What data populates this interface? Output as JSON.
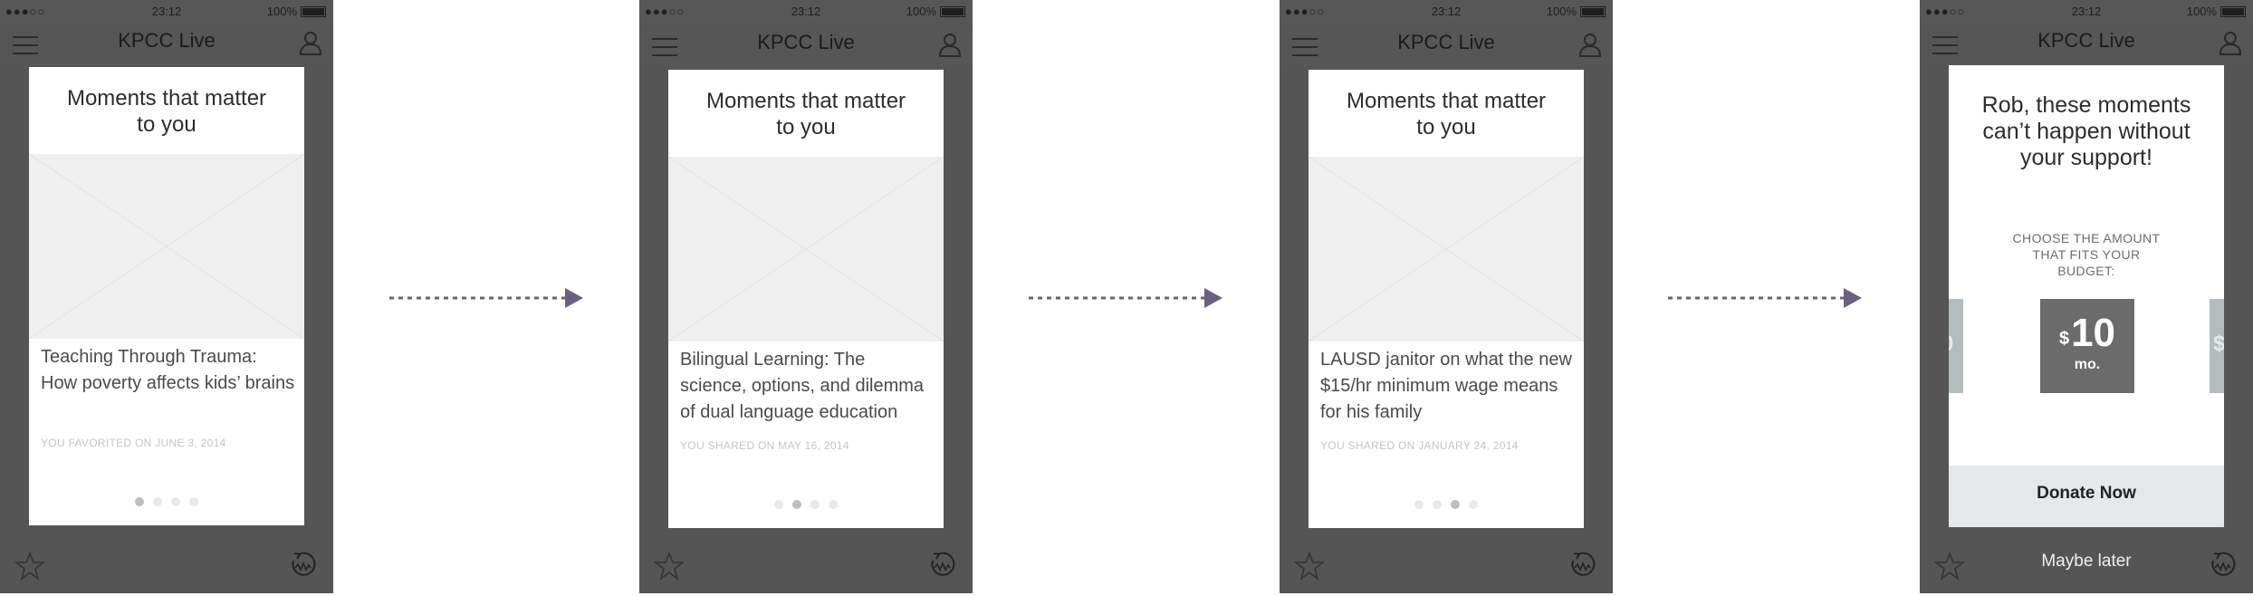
{
  "app_title": "KPCC Live",
  "status_bar": {
    "signal": "●●●○○",
    "time": "23:12",
    "battery": "100%"
  },
  "screens": [
    {
      "heading": "Moments that matter to you",
      "story": "Teaching Through Trauma: How poverty affects kids’ brains",
      "meta": "YOU FAVORITED ON JUNE 3, 2014",
      "active_dot": 0
    },
    {
      "heading": "Moments that matter to you",
      "story": "Bilingual Learning: The science, options, and dilemma of dual language education",
      "meta": "YOU SHARED ON MAY 16, 2014",
      "active_dot": 1
    },
    {
      "heading": "Moments that matter to you",
      "story": "LAUSD janitor on what the new $15/hr minimum wage means for his family",
      "meta": "YOU SHARED ON JANUARY 24, 2014",
      "active_dot": 2
    }
  ],
  "donate": {
    "heading": "Rob, these moments can’t happen without your support!",
    "choose_text": "CHOOSE THE AMOUNT THAT FITS YOUR BUDGET:",
    "amount_currency": "$",
    "amount_value": "10",
    "amount_period": "mo.",
    "side_left_glyph": "0",
    "side_right_glyph": "$",
    "donate_button": "Donate Now",
    "maybe_later": "Maybe later"
  },
  "colors": {
    "phone_bg": "#555555",
    "arrow": "#6a6180",
    "amount_tile": "#6b6b6b",
    "donate_button_bg": "#e4e8e8"
  },
  "icons": [
    "menu-icon",
    "user-icon",
    "star-icon",
    "refresh-icon",
    "arrow-icon"
  ]
}
